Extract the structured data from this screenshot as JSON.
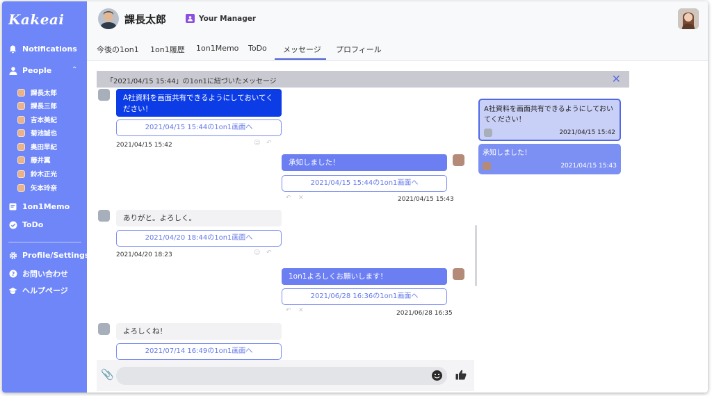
{
  "app": {
    "logo": "Kakeai"
  },
  "sidebar": {
    "notifications": "Notifications",
    "people": "People",
    "persons": [
      "課長太郎",
      "課長三郎",
      "吉本美紀",
      "菊池誠也",
      "奥田早紀",
      "藤井翼",
      "鈴木正光",
      "矢本玲奈"
    ],
    "memo": "1on1Memo",
    "todo": "ToDo",
    "settings": "Profile/Settings",
    "contact": "お問い合わせ",
    "help": "ヘルプページ"
  },
  "header": {
    "name": "課長太郎",
    "role": "Your Manager",
    "tabs": [
      "今後の1on1",
      "1on1履歴",
      "1on1Memo",
      "ToDo",
      "メッセージ",
      "プロフィール"
    ],
    "active_tab": "メッセージ"
  },
  "banner": {
    "text": "「2021/04/15 15:44」の1on1に紐づいたメッセージ"
  },
  "messages": [
    {
      "text": "A社資料を画面共有できるようにしておいてください！",
      "link": "2021/04/15 15:44の1on1画面へ",
      "time": "2021/04/15 15:42"
    },
    {
      "text": "承知しました！",
      "link": "2021/04/15 15:44の1on1画面へ",
      "time": "2021/04/15 15:43"
    },
    {
      "text": "ありがと。よろしく。",
      "link": "2021/04/20 18:44の1on1画面へ",
      "time": "2021/04/20 18:23"
    },
    {
      "text": "1on1よろしくお願いします！",
      "link": "2021/06/28 16:36の1on1画面へ",
      "time": "2021/06/28 16:35"
    },
    {
      "text": "よろしくね！",
      "link": "2021/07/14 16:49の1on1画面へ",
      "time": ""
    }
  ],
  "composer": {
    "placeholder": ""
  },
  "related": [
    {
      "text": "A社資料を画面共有できるようにしておいてください！",
      "time": "2021/04/15 15:42"
    },
    {
      "text": "承知しました！",
      "time": "2021/04/15 15:43"
    }
  ],
  "colors": {
    "sidebar": "#6e86f7",
    "accent": "#0b3ce6",
    "purple_bubble": "#6b7ef2"
  }
}
